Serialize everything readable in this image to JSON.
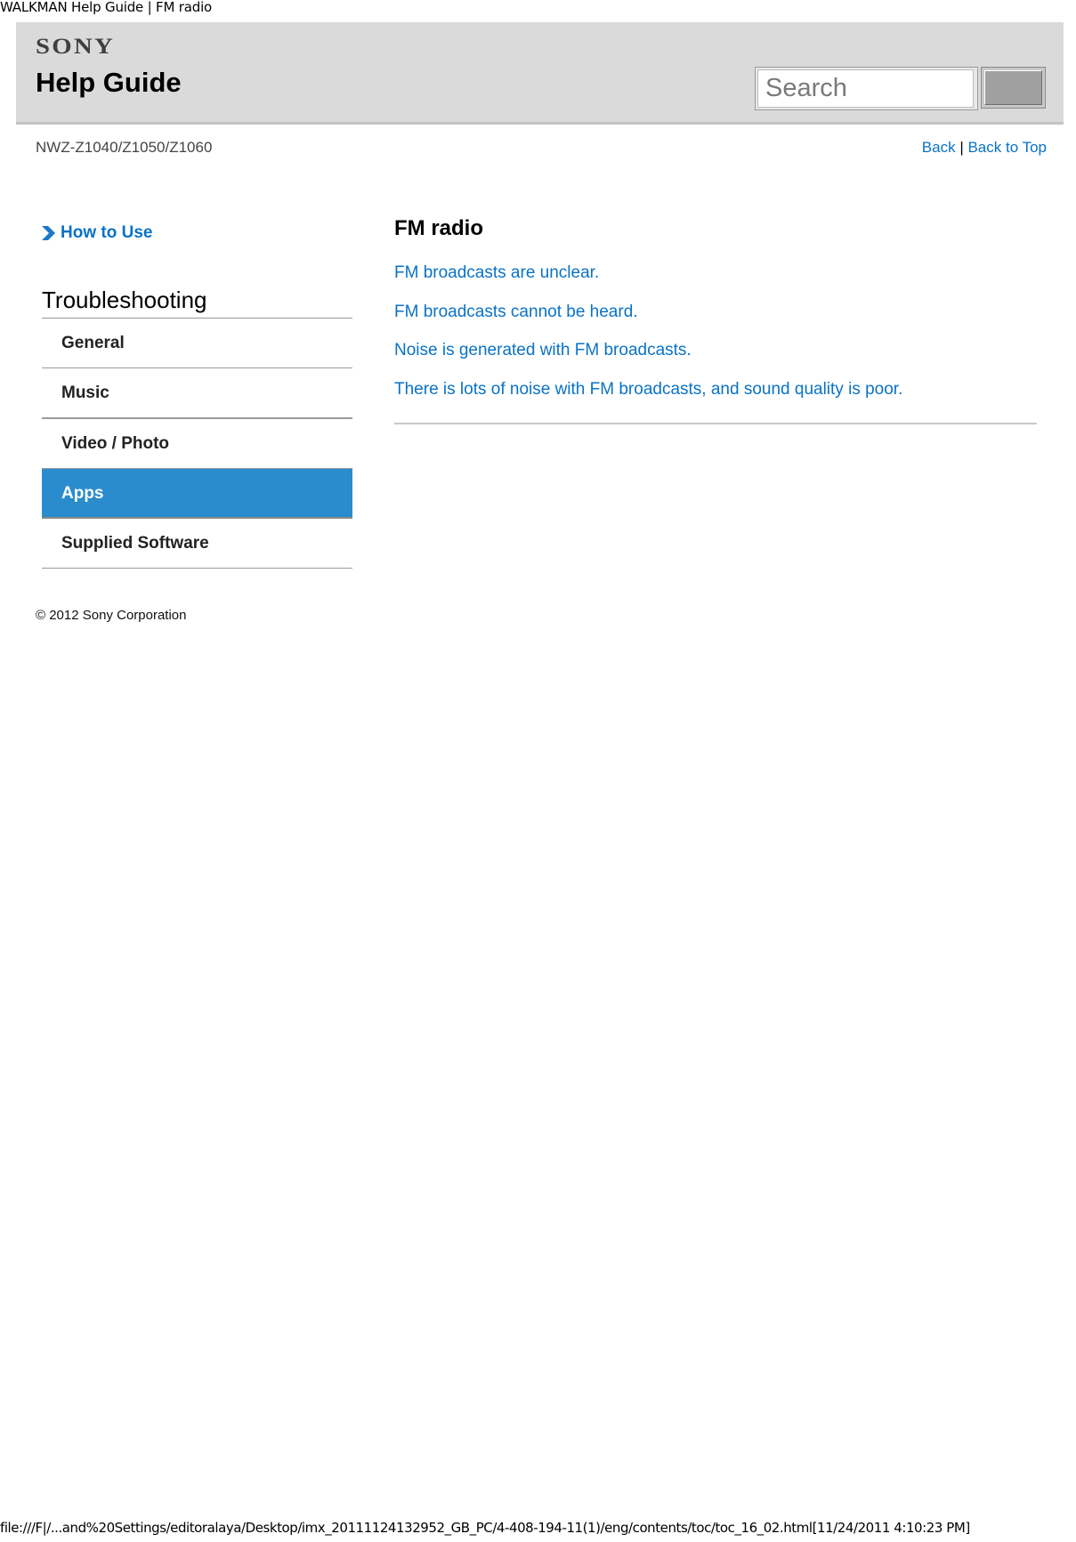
{
  "document": {
    "title": "WALKMAN Help Guide | FM radio",
    "footer_url": "file:///F|/...and%20Settings/editoralaya/Desktop/imx_20111124132952_GB_PC/4-408-194-11(1)/eng/contents/toc/toc_16_02.html[11/24/2011 4:10:23 PM]"
  },
  "header": {
    "brand": "SONY",
    "title": "Help Guide",
    "search": {
      "placeholder": "Search",
      "value": ""
    },
    "search_button_label": ""
  },
  "subheader": {
    "model": "NWZ-Z1040/Z1050/Z1060",
    "back_label": "Back",
    "separator": "|",
    "back_to_top_label": "Back to Top"
  },
  "sidebar": {
    "how_to_use": {
      "label": "How to Use",
      "icon": "chevron-right-icon"
    },
    "section_heading": "Troubleshooting",
    "items": [
      {
        "label": "General",
        "active": false
      },
      {
        "label": "Music",
        "active": false
      },
      {
        "label": "Video / Photo",
        "active": false
      },
      {
        "label": "Apps",
        "active": true
      },
      {
        "label": "Supplied Software",
        "active": false
      }
    ],
    "copyright": "© 2012 Sony Corporation"
  },
  "main": {
    "heading": "FM radio",
    "links": [
      "FM broadcasts are unclear.",
      "FM broadcasts cannot be heard.",
      "Noise is generated with FM broadcasts.",
      "There is lots of noise with FM broadcasts, and sound quality is poor."
    ]
  },
  "colors": {
    "link": "#0a72c6",
    "active_nav": "#2a8ccc",
    "header_bg": "#dadada"
  }
}
